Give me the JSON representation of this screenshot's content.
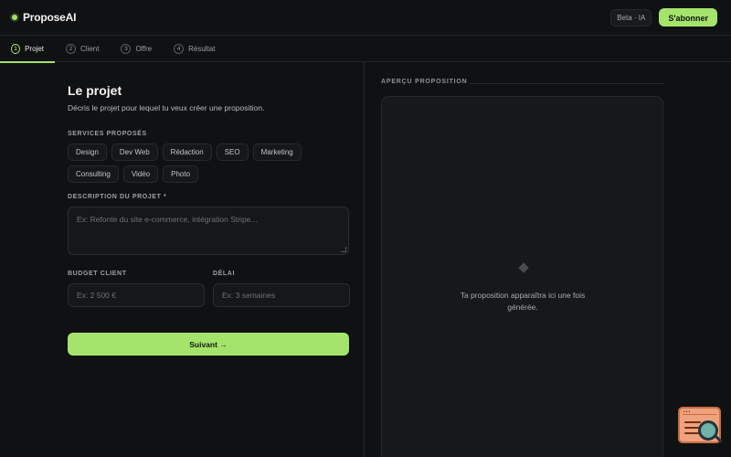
{
  "header": {
    "logo_text": "ProposeAI",
    "badge": "Beta · IA",
    "subscribe_label": "S'abonner"
  },
  "steps": [
    {
      "number": "1",
      "label": "Projet",
      "active": true
    },
    {
      "number": "2",
      "label": "Client",
      "active": false
    },
    {
      "number": "3",
      "label": "Offre",
      "active": false
    },
    {
      "number": "4",
      "label": "Résultat",
      "active": false
    }
  ],
  "form": {
    "title": "Le projet",
    "subtitle": "Décris le projet pour lequel tu veux créer une proposition.",
    "services_label": "SERVICES PROPOSÉS",
    "services": [
      "Design",
      "Dev Web",
      "Rédaction",
      "SEO",
      "Marketing",
      "Consulting",
      "Vidéo",
      "Photo"
    ],
    "description_label": "DESCRIPTION DU PROJET *",
    "description_placeholder": "Ex: Refonte du site e-commerce, intégration Stripe...",
    "budget_label": "BUDGET CLIENT",
    "budget_placeholder": "Ex: 2 500 €",
    "delay_label": "DÉLAI",
    "delay_placeholder": "Ex: 3 semaines",
    "next_label": "Suivant →"
  },
  "preview": {
    "label": "APERÇU PROPOSITION",
    "empty_text": "Ta proposition apparaîtra ici une fois générée."
  },
  "colors": {
    "accent": "#a5e46c",
    "background": "#101112",
    "panel": "#17181a"
  }
}
